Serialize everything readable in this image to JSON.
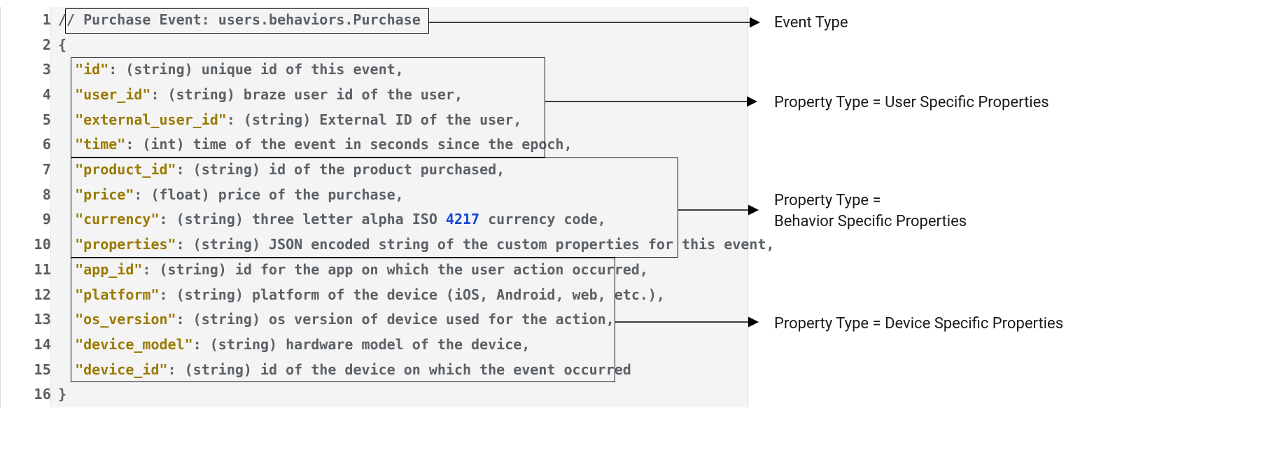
{
  "code": {
    "lines": [
      {
        "n": "1",
        "html": "<span class=\"cmt\">// Purchase Event: users.behaviors.Purchase</span>",
        "indent": 0
      },
      {
        "n": "2",
        "html": "<span class=\"txt\">{</span>",
        "indent": 0
      },
      {
        "n": "3",
        "html": "<span class=\"key\">\"id\"</span><span class=\"txt\">: (string) unique id of this event,</span>",
        "indent": 1
      },
      {
        "n": "4",
        "html": "<span class=\"key\">\"user_id\"</span><span class=\"txt\">: (string) braze user id of the user,</span>",
        "indent": 1
      },
      {
        "n": "5",
        "html": "<span class=\"key\">\"external_user_id\"</span><span class=\"txt\">: (string) External ID of the user,</span>",
        "indent": 1
      },
      {
        "n": "6",
        "html": "<span class=\"key\">\"time\"</span><span class=\"txt\">: (int) time of the event in seconds since the epoch,</span>",
        "indent": 1
      },
      {
        "n": "7",
        "html": "<span class=\"key\">\"product_id\"</span><span class=\"txt\">: (string) id of the product purchased,</span>",
        "indent": 1
      },
      {
        "n": "8",
        "html": "<span class=\"key\">\"price\"</span><span class=\"txt\">: (float) price of the purchase,</span>",
        "indent": 1
      },
      {
        "n": "9",
        "html": "<span class=\"key\">\"currency\"</span><span class=\"txt\">: (string) three letter alpha ISO </span><span class=\"num\">4217</span><span class=\"txt\"> currency code,</span>",
        "indent": 1
      },
      {
        "n": "10",
        "html": "<span class=\"key\">\"properties\"</span><span class=\"txt\">: (string) JSON encoded string of the custom properties for this event,</span>",
        "indent": 1
      },
      {
        "n": "11",
        "html": "<span class=\"key\">\"app_id\"</span><span class=\"txt\">: (string) id for the app on which the user action occurred,</span>",
        "indent": 1
      },
      {
        "n": "12",
        "html": "<span class=\"key\">\"platform\"</span><span class=\"txt\">: (string) platform of the device (iOS, Android, web, etc.),</span>",
        "indent": 1
      },
      {
        "n": "13",
        "html": "<span class=\"key\">\"os_version\"</span><span class=\"txt\">: (string) os version of device used for the action,</span>",
        "indent": 1
      },
      {
        "n": "14",
        "html": "<span class=\"key\">\"device_model\"</span><span class=\"txt\">: (string) hardware model of the device,</span>",
        "indent": 1
      },
      {
        "n": "15",
        "html": "<span class=\"key\">\"device_id\"</span><span class=\"txt\">: (string) id of the device on which the event occurred</span>",
        "indent": 1
      },
      {
        "n": "16",
        "html": "<span class=\"txt\">}</span>",
        "indent": 0
      }
    ]
  },
  "labels": {
    "event_type": "Event Type",
    "user_props": "Property Type = User Specific Properties",
    "behavior_props": "Property Type =\nBehavior Specific Properties",
    "device_props": "Property Type = Device Specific Properties"
  }
}
